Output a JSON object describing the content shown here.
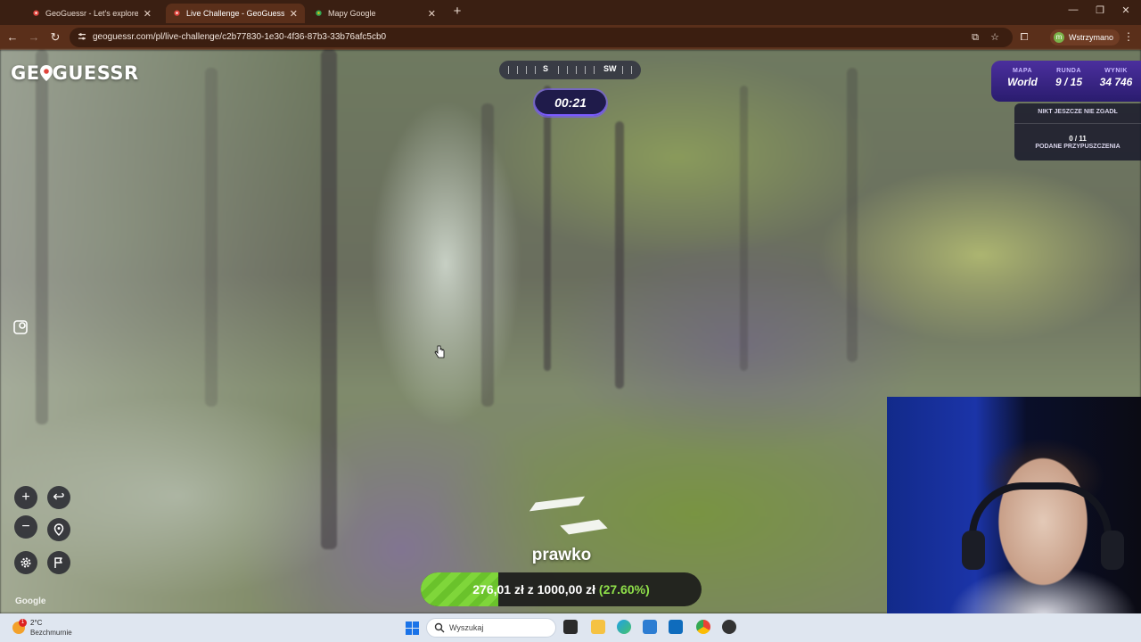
{
  "browser": {
    "tabs": [
      {
        "title": "GeoGuessr - Let's explore the w",
        "active": false
      },
      {
        "title": "Live Challenge - GeoGuessr",
        "active": true
      },
      {
        "title": "Mapy Google",
        "active": false
      }
    ],
    "url": "geoguessr.com/pl/live-challenge/c2b77830-1e30-4f36-87b3-33b76afc5cb0",
    "profile_initial": "m",
    "profile_label": "Wstrzymano"
  },
  "game": {
    "logo": "GEOGUESSR",
    "compass": {
      "dir1": "S",
      "dir2": "SW"
    },
    "timer": "00:21",
    "status": {
      "map_label": "MAPA",
      "map_value": "World",
      "round_label": "RUNDA",
      "round_value": "9 / 15",
      "score_label": "WYNIK",
      "score_value": "34 746"
    },
    "guesses": {
      "nobody_guessed": "NIKT JESZCZE NIE ZGADŁ",
      "count": "0 / 11",
      "submitted_label": "PODANE PRZYPUSZCZENIA"
    },
    "controls": {
      "zoom_in": "+",
      "zoom_out": "−",
      "back": "↩"
    },
    "attribution": "Google"
  },
  "donation": {
    "title": "prawko",
    "current": "276,01 zł",
    "separator": "z",
    "goal": "1000,00 zł",
    "percent_text": "(27.60%)",
    "percent": 0.276
  },
  "taskbar": {
    "weather_temp": "2°C",
    "weather_desc": "Bezchmurnie",
    "weather_badge": "1",
    "search_placeholder": "Wyszukaj"
  },
  "colors": {
    "accent": "#5a2f1a",
    "game_purple": "#4b2f9e",
    "progress_green": "#6ac22b"
  }
}
